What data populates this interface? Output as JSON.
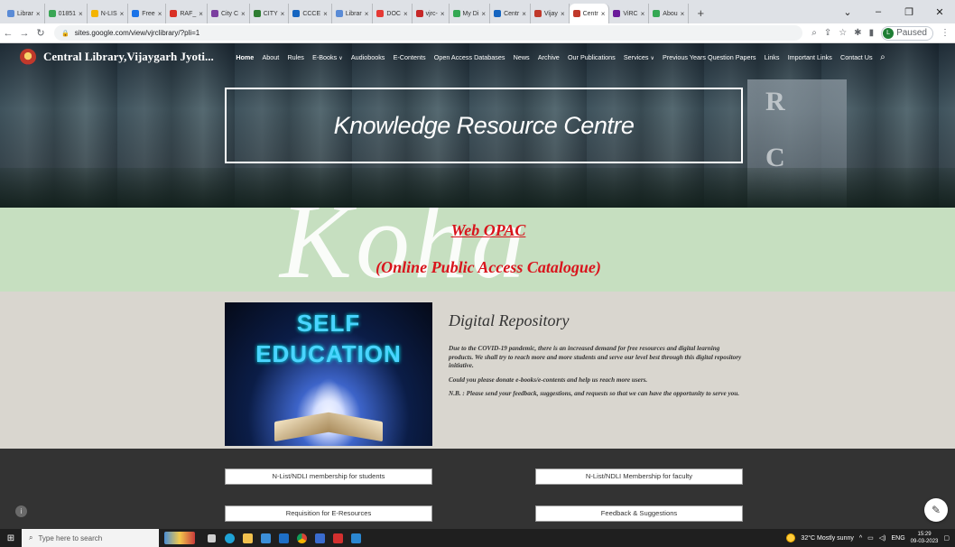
{
  "browser": {
    "tabs": [
      {
        "label": "Librar",
        "color": "#5a8bd6"
      },
      {
        "label": "01851",
        "color": "#3aa655"
      },
      {
        "label": "N-LIS",
        "color": "#f4b400"
      },
      {
        "label": "Free",
        "color": "#1a73e8"
      },
      {
        "label": "RAF_",
        "color": "#d93025"
      },
      {
        "label": "City C",
        "color": "#7b3fa0"
      },
      {
        "label": "CITY",
        "color": "#2e7d32"
      },
      {
        "label": "CCCE",
        "color": "#1565c0"
      },
      {
        "label": "Librar",
        "color": "#5a8bd6"
      },
      {
        "label": "DOC",
        "color": "#e53935"
      },
      {
        "label": "vjrc-",
        "color": "#c62828"
      },
      {
        "label": "My Di",
        "color": "#34a853"
      },
      {
        "label": "Centr",
        "color": "#1565c0"
      },
      {
        "label": "Vijay",
        "color": "#c0392b"
      },
      {
        "label": "Centr",
        "color": "#c0392b",
        "active": true
      },
      {
        "label": "ViRC",
        "color": "#6a1b9a"
      },
      {
        "label": "Abou",
        "color": "#34a853"
      }
    ],
    "new_tab": "+",
    "win_min": "–",
    "win_max": "❐",
    "win_close": "✕",
    "win_chevron": "⌄",
    "url": "sites.google.com/view/vjrclibrary/?pli=1",
    "paused_label": "Paused",
    "profile_initial": "L"
  },
  "site": {
    "name": "Central Library,Vijaygarh Jyoti...",
    "menu": [
      {
        "label": "Home",
        "home": true
      },
      {
        "label": "About"
      },
      {
        "label": "Rules"
      },
      {
        "label": "E-Books",
        "caret": true
      },
      {
        "label": "Audiobooks"
      },
      {
        "label": "E-Contents"
      },
      {
        "label": "Open Access Databases"
      },
      {
        "label": "News"
      },
      {
        "label": "Archive"
      },
      {
        "label": "Our Publications"
      },
      {
        "label": "Services",
        "caret": true
      },
      {
        "label": "Previous Years Question Papers"
      },
      {
        "label": "Links"
      },
      {
        "label": "Important Links"
      },
      {
        "label": "Contact Us"
      }
    ],
    "hero_title": "Knowledge Resource Centre",
    "hero_letters": {
      "r": "R",
      "c": "C"
    },
    "opac": {
      "watermark": "Koha",
      "link": "Web OPAC",
      "subtitle": "(Online Public Access Catalogue)"
    },
    "repository": {
      "image_line1": "SELF",
      "image_line2": "EDUCATION",
      "heading": "Digital Repository",
      "paragraphs": [
        "Due to the COVID-19 pandemic, there is an increased demand for free resources and digital learning products. We shall try to reach more and more students and serve our level best through this digital repository initiative.",
        "Could you please donate e-books/e-contents and help us reach more users.",
        "N.B. : Please send your feedback, suggestions, and requests so that we can have the opportunity to serve you."
      ]
    },
    "buttons": {
      "nlist_students": "N-List/NDLI membership for students",
      "nlist_faculty": "N-List/NDLI Membership for faculty",
      "requisition": "Requisition for E-Resources",
      "feedback": "Feedback & Suggestions"
    }
  },
  "taskbar": {
    "search_placeholder": "Type here to search",
    "weather": "32°C  Mostly sunny",
    "lang": "ENG",
    "time": "15:29",
    "date": "09-03-2023"
  }
}
